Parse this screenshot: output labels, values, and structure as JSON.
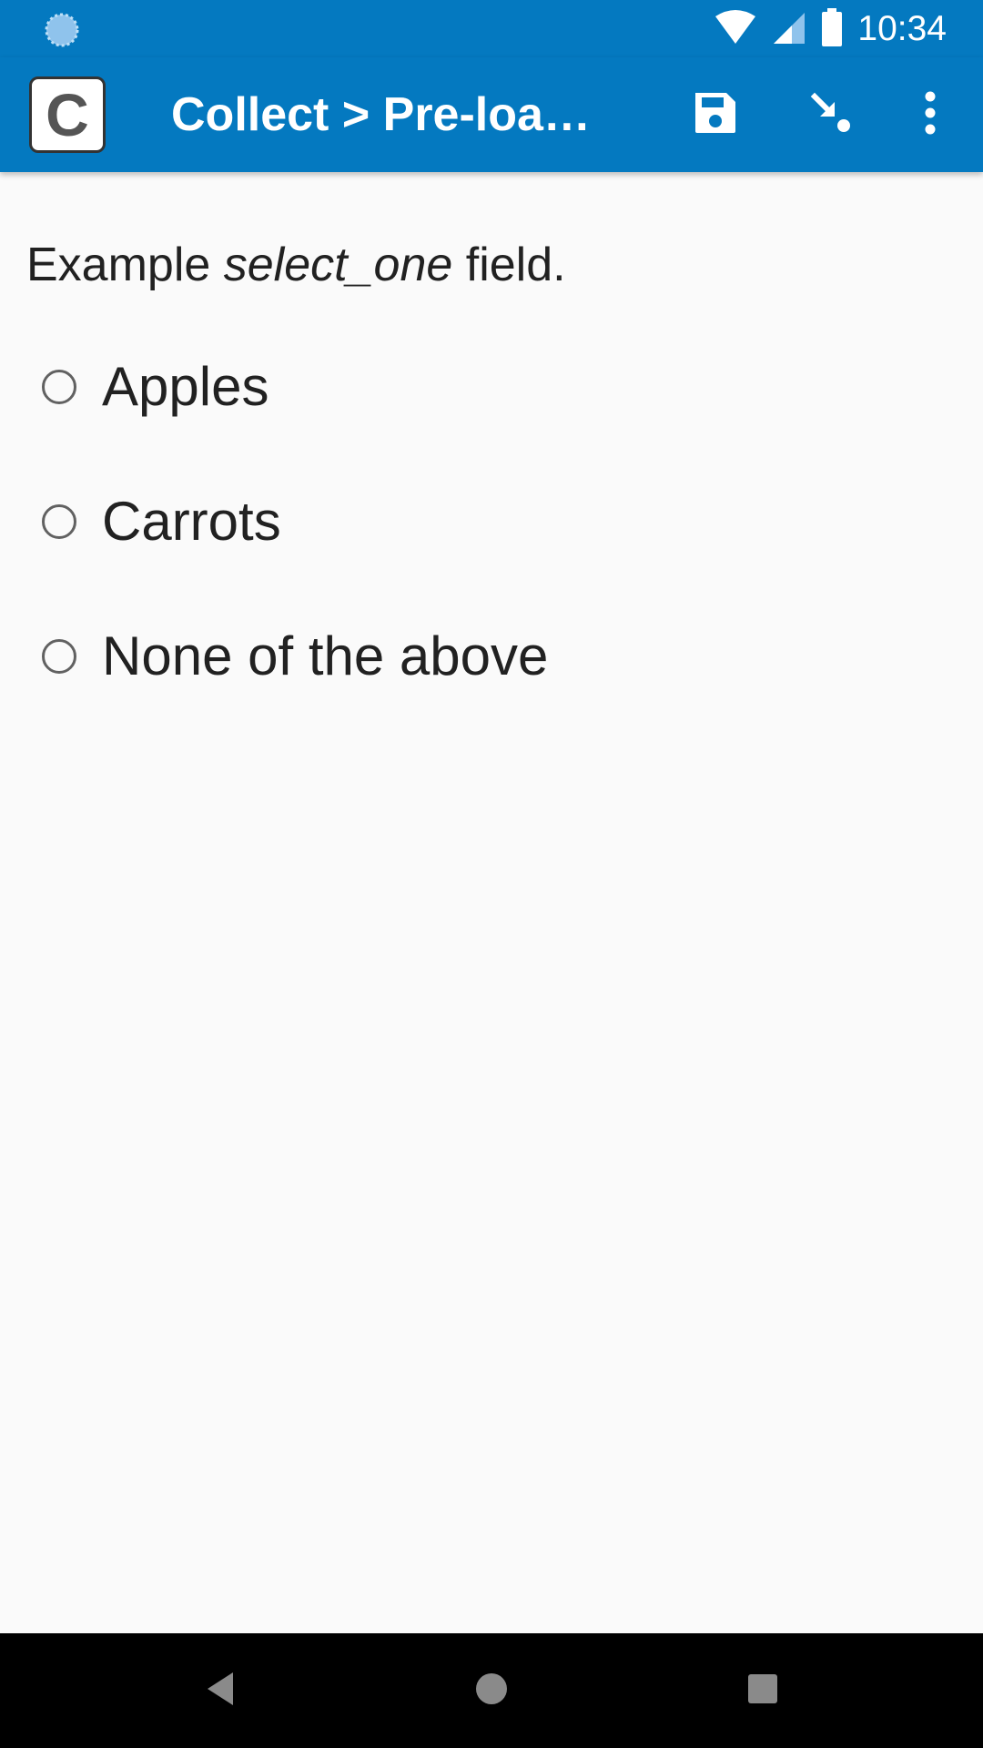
{
  "status_bar": {
    "time": "10:34",
    "left_icon": "sync-loading-icon",
    "wifi_icon": "wifi-icon",
    "signal_icon": "cell-signal-icon",
    "battery_icon": "battery-icon"
  },
  "app_bar": {
    "logo_letter": "C",
    "title": "Collect > Pre-load…",
    "actions": {
      "save_icon": "save-icon",
      "jump_icon": "go-to-prompt-icon",
      "menu_icon": "more-vert-icon"
    }
  },
  "question": {
    "prefix": "Example ",
    "italic": "select_one",
    "suffix": " field."
  },
  "options": [
    {
      "label": "Apples",
      "selected": false
    },
    {
      "label": "Carrots",
      "selected": false
    },
    {
      "label": "None of the above",
      "selected": false
    }
  ],
  "nav_bar": {
    "back_icon": "back-triangle-icon",
    "home_icon": "home-circle-icon",
    "recents_icon": "recents-square-icon"
  },
  "colors": {
    "primary": "#0479c0",
    "background": "#fafafa",
    "text": "#212121"
  }
}
